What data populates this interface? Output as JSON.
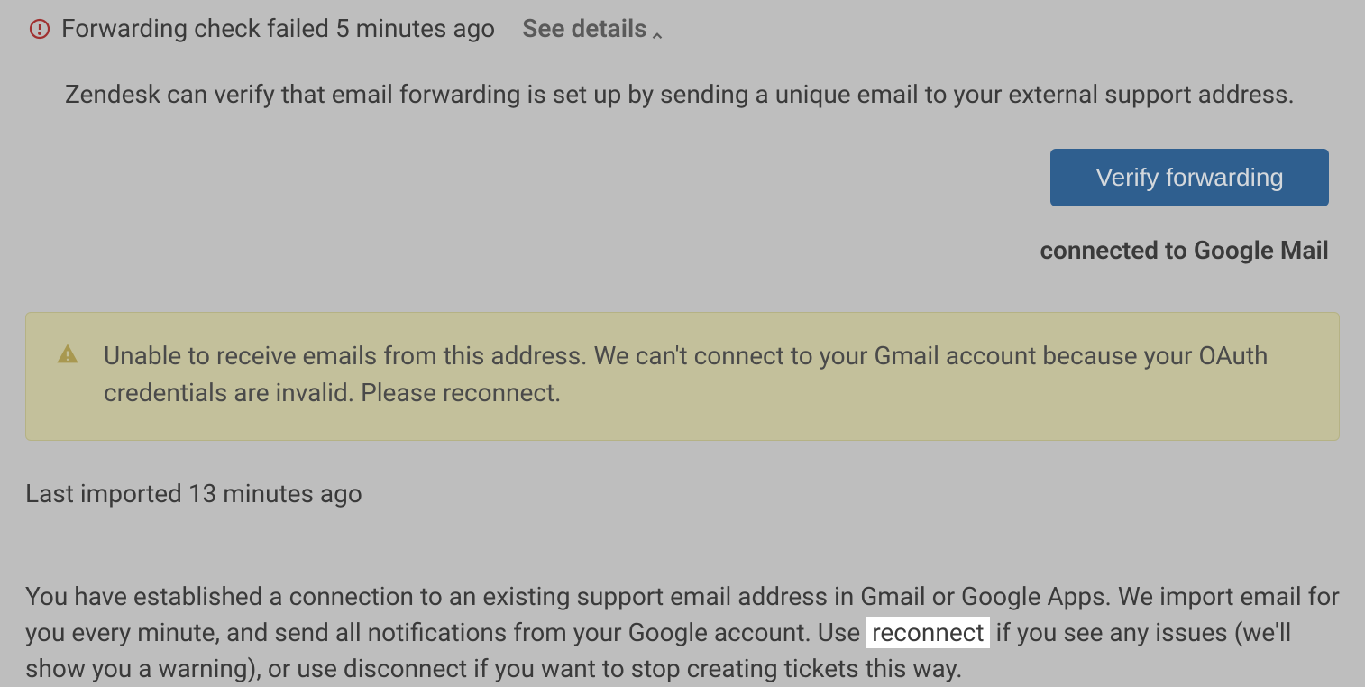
{
  "header": {
    "status_text": "Forwarding check failed 5 minutes ago",
    "see_details_label": "See details"
  },
  "description": "Zendesk can verify that email forwarding is set up by sending a unique email to your external support address.",
  "verify_button_label": "Verify forwarding",
  "connected_status": "connected to Google Mail",
  "warning": {
    "message": "Unable to receive emails from this address. We can't connect to your Gmail account because your OAuth credentials are invalid. Please reconnect."
  },
  "last_imported_text": "Last imported 13 minutes ago",
  "connection_info": {
    "part1": "You have established a connection to an existing support email address in Gmail or Google Apps. We import email for you every minute, and send all notifications from your Google account. Use ",
    "highlighted": "reconnect",
    "part2": " if you see any issues (we'll show you a warning), or use disconnect if you want to stop creating tickets this way."
  },
  "colors": {
    "background": "#bebebe",
    "button_bg": "#2f5f8f",
    "warning_bg": "#c3c09b",
    "text": "#3a3a3a",
    "alert_red": "#a03030"
  }
}
